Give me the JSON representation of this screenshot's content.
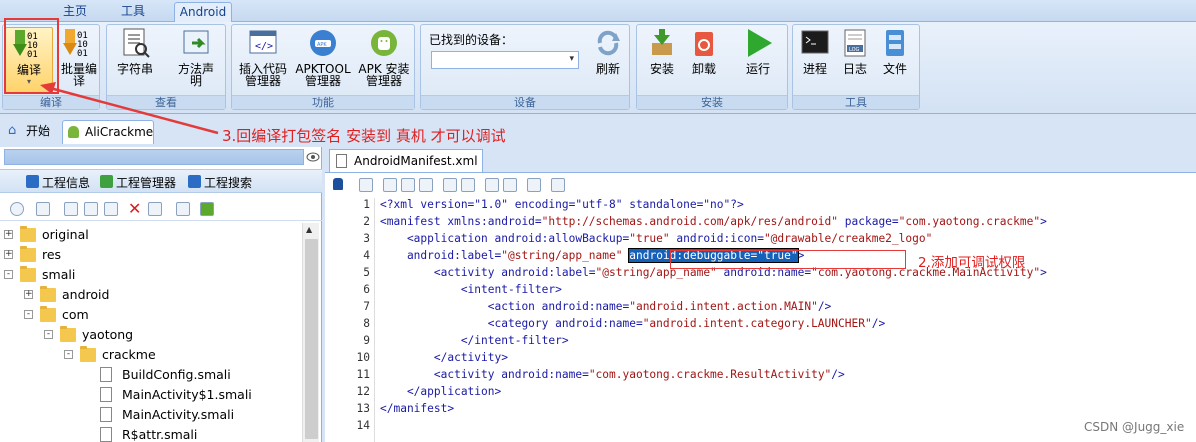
{
  "menu": {
    "tabs": [
      "主页",
      "工具",
      "Android"
    ]
  },
  "ribbon": {
    "compile": {
      "compile_label": "编译",
      "batch_label": "批量编\n译",
      "group_label": "编译"
    },
    "view": {
      "strings_label": "字符串",
      "method_sig_label": "方法声\n明",
      "group_label": "查看"
    },
    "function": {
      "insert_code_label": "插入代码\n管理器",
      "apktool_label": "APKTOOL\n管理器",
      "apk_install_label": "APK 安装\n管理器",
      "group_label": "功能"
    },
    "device": {
      "found_label": "已找到的设备：",
      "refresh_label": "刷新",
      "group_label": "设备"
    },
    "install": {
      "install_label": "安装",
      "uninstall_label": "卸载",
      "run_label": "运行",
      "group_label": "安装"
    },
    "tools": {
      "process_label": "进程",
      "log_label": "日志",
      "file_label": "文件",
      "group_label": "工具"
    }
  },
  "annotations": {
    "step3": "3.回编译打包签名 安装到 真机 才可以调试",
    "step2": "2.添加可调试权限"
  },
  "panel_tabs": {
    "start": "开始",
    "project": "AliCrackme"
  },
  "left_panel": {
    "subtabs": [
      "工程信息",
      "工程管理器",
      "工程搜索"
    ],
    "tree": [
      {
        "label": "original",
        "level": 0,
        "type": "folder",
        "exp": "+"
      },
      {
        "label": "res",
        "level": 0,
        "type": "folder",
        "exp": "+"
      },
      {
        "label": "smali",
        "level": 0,
        "type": "folder",
        "exp": "-"
      },
      {
        "label": "android",
        "level": 1,
        "type": "folder",
        "exp": "+"
      },
      {
        "label": "com",
        "level": 1,
        "type": "folder",
        "exp": "-"
      },
      {
        "label": "yaotong",
        "level": 2,
        "type": "folder",
        "exp": "-"
      },
      {
        "label": "crackme",
        "level": 3,
        "type": "folder",
        "exp": "-"
      },
      {
        "label": "BuildConfig.smali",
        "level": 4,
        "type": "file",
        "exp": ""
      },
      {
        "label": "MainActivity$1.smali",
        "level": 4,
        "type": "file",
        "exp": ""
      },
      {
        "label": "MainActivity.smali",
        "level": 4,
        "type": "file",
        "exp": ""
      },
      {
        "label": "R$attr.smali",
        "level": 4,
        "type": "file",
        "exp": ""
      }
    ]
  },
  "editor": {
    "tab_title": "AndroidManifest.xml",
    "lines": [
      "1",
      "2",
      "3",
      "4",
      "5",
      "6",
      "7",
      "8",
      "9",
      "10",
      "11",
      "12",
      "13",
      "14"
    ],
    "code": {
      "l1": "<?xml version=\"1.0\" encoding=\"utf-8\" standalone=\"no\"?>",
      "l2a": "<manifest xmlns:android=",
      "l2b": "\"http://schemas.android.com/apk/res/android\"",
      "l2c": " package=",
      "l2d": "\"com.yaotong.crackme\"",
      "l2e": ">",
      "l3a": "    <application android:allowBackup=",
      "l3b": "\"true\"",
      "l3c": " android:icon=",
      "l3d": "\"@drawable/creakme2_logo\"",
      "l4a": "    android:label=",
      "l4b": "\"@string/app_name\"",
      "l4sel": "android:debuggable=\"true\"",
      "l4e": ">",
      "l5a": "        <activity android:label=",
      "l5b": "\"@string/app_name\"",
      "l5c": " android:name=",
      "l5d": "\"com.yaotong.crackme.MainActivity\"",
      "l5e": ">",
      "l6": "            <intent-filter>",
      "l7a": "                <action android:name=",
      "l7b": "\"android.intent.action.MAIN\"",
      "l7c": "/>",
      "l8a": "                <category android:name=",
      "l8b": "\"android.intent.category.LAUNCHER\"",
      "l8c": "/>",
      "l9": "            </intent-filter>",
      "l10": "        </activity>",
      "l11a": "        <activity android:name=",
      "l11b": "\"com.yaotong.crackme.ResultActivity\"",
      "l11c": "/>",
      "l12": "    </application>",
      "l13": "</manifest>"
    }
  },
  "watermark": "CSDN @Jugg_xie",
  "colors": {
    "accent": "#15428b",
    "annotation": "#e43a3a",
    "selection": "#1560b8"
  }
}
